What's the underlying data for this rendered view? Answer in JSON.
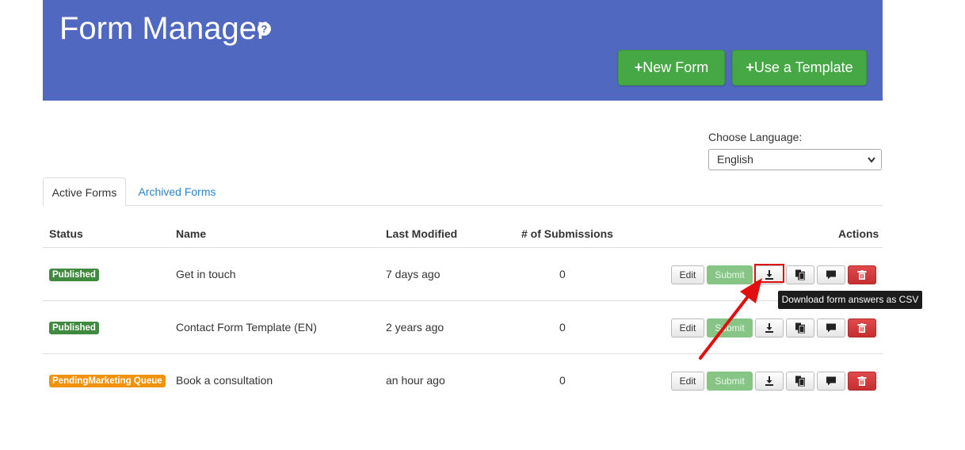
{
  "header": {
    "title": "Form Manager",
    "help_symbol": "?",
    "new_form_label": "New Form",
    "use_template_label": "Use a Template",
    "plus": "+",
    "bg_color": "#5068c0"
  },
  "language": {
    "label": "Choose Language:",
    "selected": "English"
  },
  "tabs": [
    {
      "label": "Active Forms",
      "active": true
    },
    {
      "label": "Archived Forms",
      "active": false
    }
  ],
  "table": {
    "headers": {
      "status": "Status",
      "name": "Name",
      "last_modified": "Last Modified",
      "submissions": "# of Submissions",
      "actions": "Actions"
    },
    "rows": [
      {
        "status": "Published",
        "status_color": "#3f8a3f",
        "name": "Get in touch",
        "last_modified": "7 days ago",
        "submissions": "0"
      },
      {
        "status": "Published",
        "status_color": "#3f8a3f",
        "name": "Contact Form Template (EN)",
        "last_modified": "2 years ago",
        "submissions": "0"
      },
      {
        "status": "PendingMarketing Queue",
        "status_color": "#f0920c",
        "name": "Book a consultation",
        "last_modified": "an hour ago",
        "submissions": "0"
      }
    ],
    "action_labels": {
      "edit": "Edit",
      "submit": "Submit"
    },
    "action_icons": [
      "download-icon",
      "copy-icon",
      "comment-icon",
      "trash-icon"
    ]
  },
  "tooltip": {
    "text": "Download form answers as CSV"
  },
  "annotation": {
    "arrow_color": "#e01010"
  }
}
